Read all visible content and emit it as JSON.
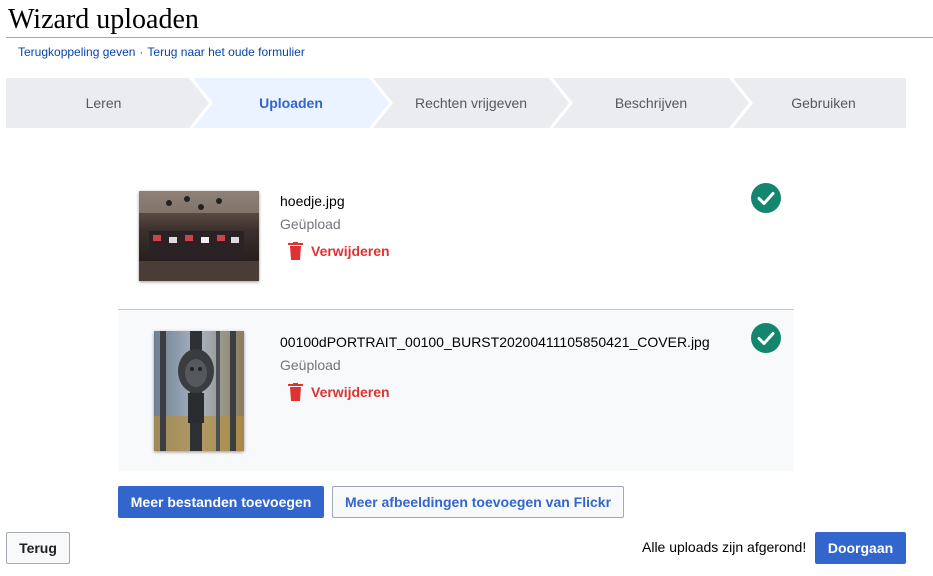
{
  "header": {
    "title": "Wizard uploaden",
    "feedback_link": "Terugkoppeling geven",
    "separator": "·",
    "old_form_link": "Terug naar het oude formulier"
  },
  "steps": [
    {
      "label": "Leren",
      "state": "inactive"
    },
    {
      "label": "Uploaden",
      "state": "active"
    },
    {
      "label": "Rechten vrijgeven",
      "state": "inactive"
    },
    {
      "label": "Beschrijven",
      "state": "inactive"
    },
    {
      "label": "Gebruiken",
      "state": "inactive"
    }
  ],
  "files": [
    {
      "name": "hoedje.jpg",
      "status": "Geüpload",
      "remove_label": "Verwijderen",
      "icon": "check-circle-icon"
    },
    {
      "name": "00100dPORTRAIT_00100_BURST20200411105850421_COVER.jpg",
      "status": "Geüpload",
      "remove_label": "Verwijderen",
      "icon": "check-circle-icon"
    }
  ],
  "actions": {
    "add_more": "Meer bestanden toevoegen",
    "add_flickr": "Meer afbeeldingen toevoegen van Flickr",
    "back": "Terug",
    "all_done": "Alle uploads zijn afgerond!",
    "continue": "Doorgaan"
  },
  "colors": {
    "accent": "#3366cc",
    "danger": "#d33333",
    "success": "#14866d",
    "step_inactive_bg": "#eaecf0",
    "step_active_bg": "#eaf3ff"
  }
}
